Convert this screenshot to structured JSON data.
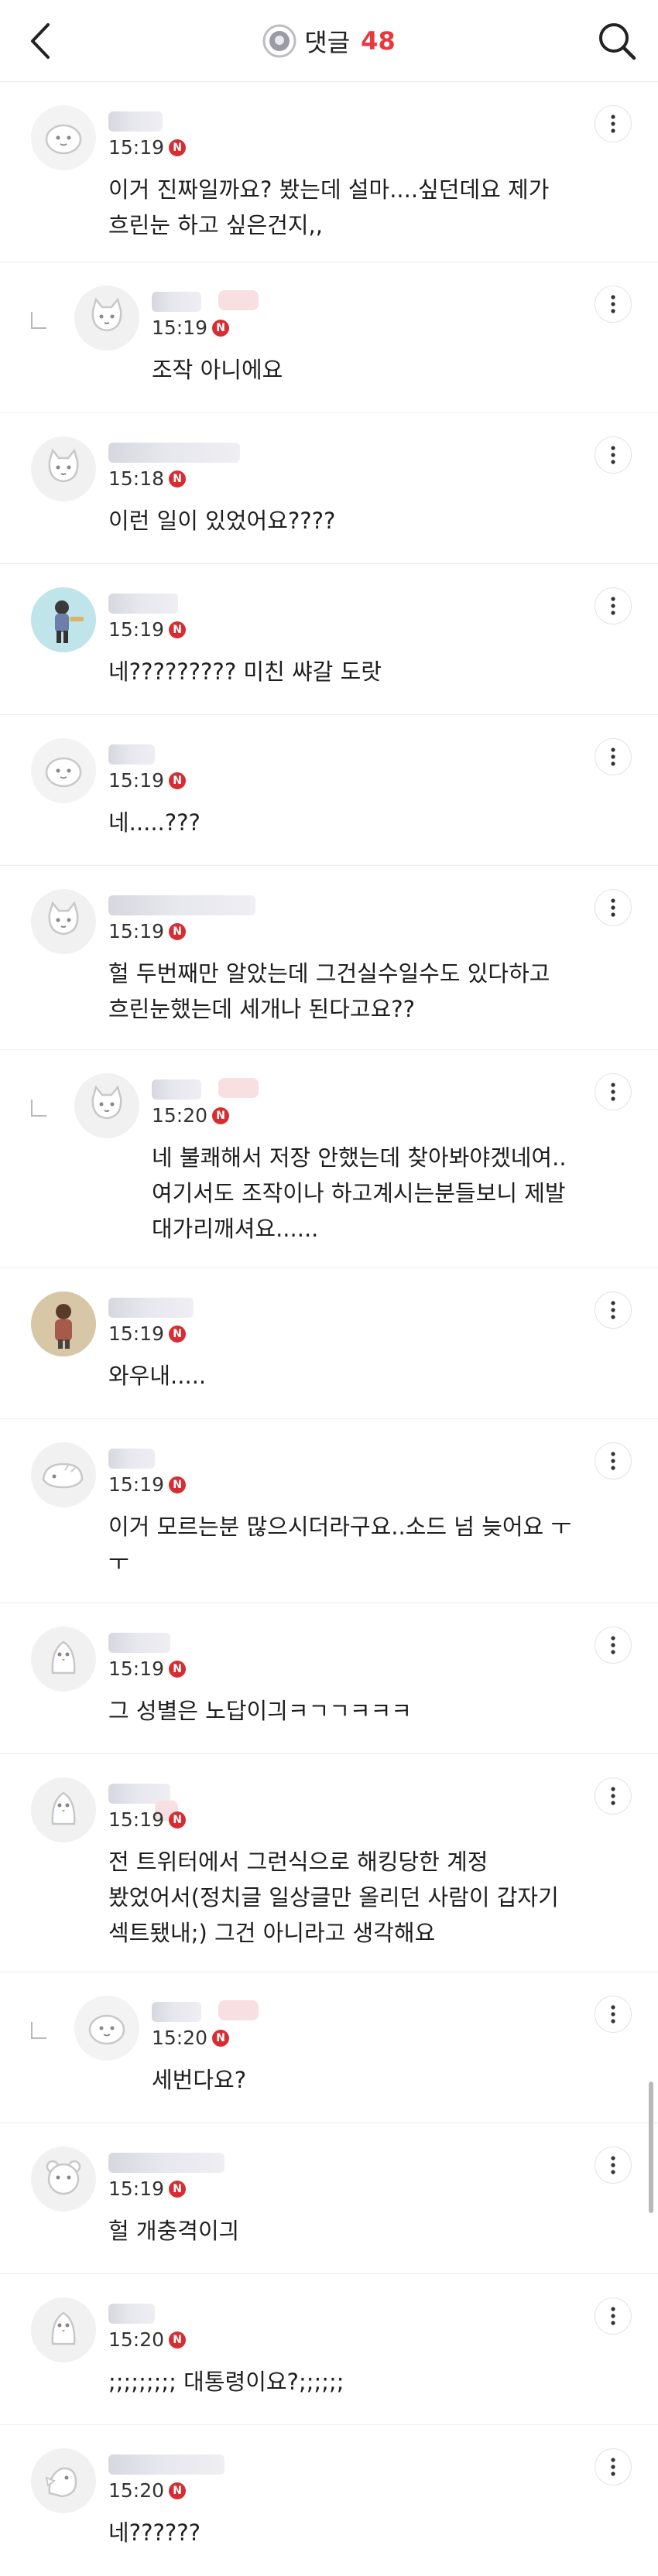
{
  "header": {
    "back_icon": "chevron-left-icon",
    "bubble_icon": "comment-bubble-icon",
    "title": "댓글",
    "count": "48",
    "search_icon": "search-icon",
    "accent": "#e8383d"
  },
  "comments": [
    {
      "time": "15:19",
      "badge": "N",
      "text": "이거 진짜일까요? 봤는데 설마....싶던데요 제가\n흐린눈 하고 싶은건지,,"
    },
    {
      "time": "15:19",
      "badge": "N",
      "text": "조작 아니에요"
    },
    {
      "time": "15:18",
      "badge": "N",
      "text": "이런 일이 있었어요????"
    },
    {
      "time": "15:19",
      "badge": "N",
      "text": "네????????? 미친 쌰갈 도랏"
    },
    {
      "time": "15:19",
      "badge": "N",
      "text": "네.....???"
    },
    {
      "time": "15:19",
      "badge": "N",
      "text": "헐 두번째만 알았는데 그건실수일수도 있다하고\n흐린눈했는데 세개나 된다고요??"
    },
    {
      "time": "15:20",
      "badge": "N",
      "text": "네 불쾌해서 저장 안했는데 찾아봐야겠네여..\n여기서도 조작이나 하고계시는분들보니 제발\n대가리깨셔요......"
    },
    {
      "time": "15:19",
      "badge": "N",
      "text": "와우내....."
    },
    {
      "time": "15:19",
      "badge": "N",
      "text": "이거 모르는분 많으시더라구요..소드 넘 늦어요 ㅜ\nㅜ"
    },
    {
      "time": "15:19",
      "badge": "N",
      "text": "그 성별은 노답이긔ㅋㄱㄱㅋㅋㅋ"
    },
    {
      "time": "15:19",
      "badge": "N",
      "text": "전 트위터에서 그런식으로 해킹당한 계정\n봤었어서(정치글 일상글만 올리던 사람이 갑자기\n섹트됐내;) 그건 아니라고 생각해요"
    },
    {
      "time": "15:20",
      "badge": "N",
      "text": "세번다요?"
    },
    {
      "time": "15:19",
      "badge": "N",
      "text": "헐 개충격이긔"
    },
    {
      "time": "15:20",
      "badge": "N",
      "text": ";;;;;;;;; 대통령이요?;;;;;;"
    },
    {
      "time": "15:20",
      "badge": "N",
      "text": "네??????"
    }
  ]
}
